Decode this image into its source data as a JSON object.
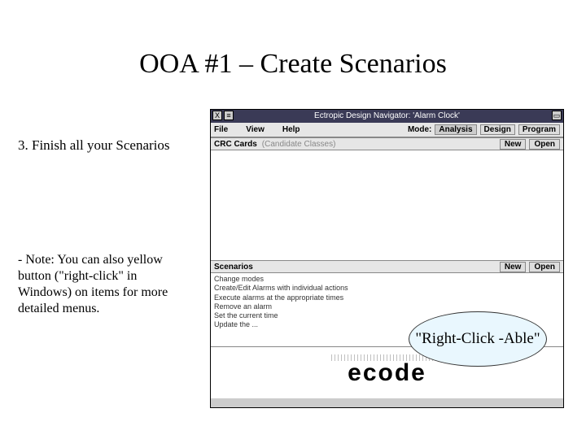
{
  "title": "OOA #1 – Create Scenarios",
  "left": {
    "step": "3.  Finish all your Scenarios",
    "note": "- Note:  You can also yellow button (\"right-click\" in Windows) on items for more detailed menus."
  },
  "app": {
    "titlebar": {
      "close": "X",
      "min": "≡",
      "title": "Ectropic Design Navigator: 'Alarm Clock'",
      "resize": "▭"
    },
    "menu": {
      "file": "File",
      "view": "View",
      "help": "Help",
      "mode_label": "Mode:",
      "analysis": "Analysis",
      "design": "Design",
      "program": "Program"
    },
    "crc": {
      "title": "CRC Cards",
      "sub": "(Candidate Classes)",
      "new": "New",
      "open": "Open"
    },
    "scenarios": {
      "title": "Scenarios",
      "new": "New",
      "open": "Open",
      "items": [
        "Change modes",
        "Create/Edit Alarms with individual actions",
        "Execute alarms at the appropriate times",
        "Remove an alarm",
        "Set the current time",
        "Update the ..."
      ]
    },
    "logo": "ecode"
  },
  "callout": "\"Right-Click -Able\""
}
